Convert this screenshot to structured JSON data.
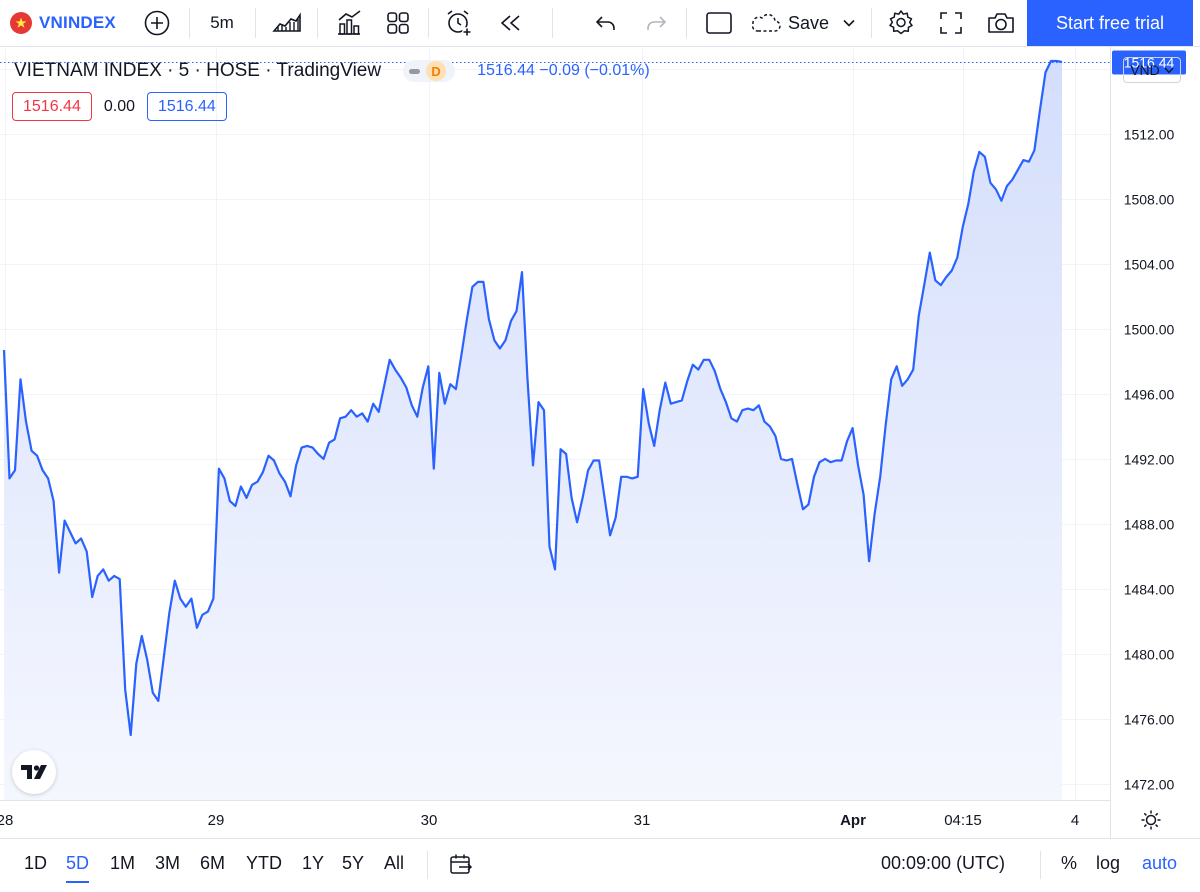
{
  "toolbar": {
    "symbol": "VNINDEX",
    "interval": "5m",
    "save_label": "Save",
    "trial_label": "Start free trial",
    "accent": "#2962ff",
    "flag_color": "#e53935",
    "icons": [
      "plus-circle-icon",
      "area-chart-icon",
      "indicators-icon",
      "layouts-icon",
      "alert-icon",
      "replay-icon",
      "undo-icon",
      "redo-icon",
      "rectangle-icon",
      "cloud-icon",
      "chevron-down-icon",
      "gear-icon",
      "fullscreen-icon",
      "camera-icon"
    ]
  },
  "legend": {
    "title": "VIETNAM INDEX · 5 · HOSE · TradingView",
    "badge": "D",
    "price": "1516.44",
    "change": "−0.09",
    "change_pct": "(−0.01%)",
    "bid": "1516.44",
    "spread": "0.00",
    "ask": "1516.44"
  },
  "currency": "VND",
  "chart_data": {
    "type": "area",
    "line_color": "#2962ff",
    "fill_top": "#d4defc",
    "fill_bottom": "#f5f7fe",
    "y_ticks": [
      "1472.00",
      "1476.00",
      "1480.00",
      "1484.00",
      "1488.00",
      "1492.00",
      "1496.00",
      "1500.00",
      "1504.00",
      "1508.00",
      "1512.00",
      "1516.00"
    ],
    "ylim": [
      1471.0,
      1517.3
    ],
    "last_price_label": "1516.44",
    "last_price": 1516.44,
    "x_labels": [
      "28",
      "29",
      "30",
      "31",
      "Apr",
      "04:15",
      "4"
    ],
    "x_label_bold": [
      "Apr"
    ],
    "grid": true,
    "series": [
      {
        "values": [
          1498.7,
          1490.8,
          1491.3,
          1496.9,
          1494.3,
          1492.5,
          1492.2,
          1491.3,
          1490.8,
          1489.4,
          1485.0,
          1488.2,
          1487.5,
          1486.8,
          1487.1,
          1486.3,
          1483.5,
          1484.8,
          1485.2,
          1484.5,
          1484.8,
          1484.6,
          1477.8,
          1475.0,
          1479.4,
          1481.1,
          1479.6,
          1477.6,
          1477.1,
          1479.8,
          1482.5,
          1484.5,
          1483.4,
          1482.9,
          1483.4,
          1481.6,
          1482.4,
          1482.6,
          1483.4,
          1491.4,
          1490.8,
          1489.4,
          1489.1,
          1490.3,
          1489.6,
          1490.4,
          1490.6,
          1491.2,
          1492.2,
          1491.9,
          1491.1,
          1490.6,
          1489.7,
          1491.6,
          1492.7,
          1492.8,
          1492.7,
          1492.3,
          1492.0,
          1493.0,
          1493.2,
          1494.5,
          1494.6,
          1495.0,
          1494.6,
          1494.8,
          1494.3,
          1495.4,
          1494.9,
          1496.5,
          1498.1,
          1497.5,
          1497.0,
          1496.4,
          1495.3,
          1494.6,
          1496.4,
          1497.7,
          1491.4,
          1497.3,
          1495.4,
          1496.6,
          1496.3,
          1498.4,
          1500.6,
          1502.6,
          1502.9,
          1502.9,
          1500.6,
          1499.3,
          1498.8,
          1499.3,
          1500.5,
          1501.1,
          1503.5,
          1496.9,
          1491.6,
          1495.5,
          1495.0,
          1486.6,
          1485.2,
          1492.6,
          1492.3,
          1489.6,
          1488.1,
          1489.6,
          1491.3,
          1491.9,
          1491.9,
          1489.6,
          1487.3,
          1488.4,
          1490.9,
          1490.9,
          1490.8,
          1490.9,
          1496.3,
          1494.2,
          1492.8,
          1495.0,
          1496.7,
          1495.4,
          1495.5,
          1495.6,
          1496.8,
          1497.8,
          1497.5,
          1498.1,
          1498.1,
          1497.4,
          1496.3,
          1495.5,
          1494.5,
          1494.3,
          1495.0,
          1495.1,
          1495.0,
          1495.3,
          1494.3,
          1494.0,
          1493.4,
          1492.0,
          1491.9,
          1492.0,
          1490.4,
          1488.9,
          1489.2,
          1490.9,
          1491.8,
          1492.0,
          1491.8,
          1491.9,
          1491.9,
          1493.1,
          1493.9,
          1491.6,
          1489.8,
          1485.7,
          1488.6,
          1490.9,
          1494.1,
          1496.9,
          1497.7,
          1496.5,
          1496.9,
          1497.5,
          1500.8,
          1502.7,
          1504.7,
          1503.0,
          1502.7,
          1503.2,
          1503.6,
          1504.4,
          1506.3,
          1507.7,
          1509.7,
          1510.9,
          1510.6,
          1509.0,
          1508.6,
          1507.9,
          1508.8,
          1509.2,
          1509.8,
          1510.4,
          1510.3,
          1511.0,
          1513.5,
          1515.8,
          1516.5,
          1516.5,
          1516.44
        ]
      }
    ]
  },
  "bottom": {
    "ranges": [
      "1D",
      "5D",
      "1M",
      "3M",
      "6M",
      "YTD",
      "1Y",
      "5Y",
      "All"
    ],
    "active_range": "5D",
    "time": "00:09:00 (UTC)",
    "percent": "%",
    "log": "log",
    "auto": "auto"
  }
}
